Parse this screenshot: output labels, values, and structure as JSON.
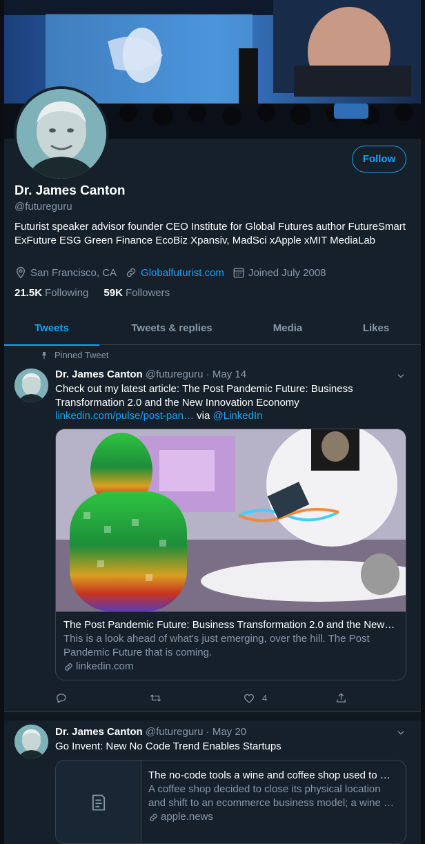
{
  "profile": {
    "follow_label": "Follow",
    "name": "Dr. James Canton",
    "handle": "@futureguru",
    "bio": "Futurist speaker advisor founder CEO Institute for Global Futures author FutureSmart ExFuture ESG Green Finance EcoBiz Xpansiv, MadSci xApple xMIT MediaLab",
    "location": "San Francisco, CA",
    "website": "Globalfuturist.com",
    "joined": "Joined July 2008",
    "following_count": "21.5K",
    "following_label": "Following",
    "followers_count": "59K",
    "followers_label": "Followers"
  },
  "tabs": [
    {
      "label": "Tweets",
      "active": true
    },
    {
      "label": "Tweets & replies",
      "active": false
    },
    {
      "label": "Media",
      "active": false
    },
    {
      "label": "Likes",
      "active": false
    }
  ],
  "tweets": [
    {
      "pinned_label": "Pinned Tweet",
      "name": "Dr. James Canton",
      "handle": "@futureguru",
      "date": "May 14",
      "text_main": "Check out my latest article: The Post Pandemic Future: Business Transformation 2.0 and the New Innovation Economy",
      "link_text": "linkedin.com/pulse/post-pan…",
      "via_text": "via",
      "mention": "@LinkedIn",
      "card": {
        "title": "The Post Pandemic Future: Business Transformation 2.0 and the New…",
        "description": "This is a look ahead of what's just emerging, over the hill. The Post Pandemic Future that is coming.",
        "domain": "linkedin.com"
      },
      "likes": "4"
    },
    {
      "name": "Dr. James Canton",
      "handle": "@futureguru",
      "date": "May 20",
      "text_main": "Go Invent: New No Code Trend Enables Startups",
      "card": {
        "title": "The no-code tools a wine and coffee shop used to …",
        "description": "A coffee shop decided to close its physical location and shift to an ecommerce business model; a wine …",
        "domain": "apple.news"
      }
    }
  ],
  "colors": {
    "background": "#15202b",
    "accent": "#1da1f2",
    "secondary_text": "#8899a6",
    "border": "#38444d"
  },
  "icons": [
    "location-icon",
    "link-icon",
    "calendar-icon",
    "pin-icon",
    "chevron-down-icon",
    "reply-icon",
    "retweet-icon",
    "like-icon",
    "share-icon",
    "article-icon"
  ]
}
